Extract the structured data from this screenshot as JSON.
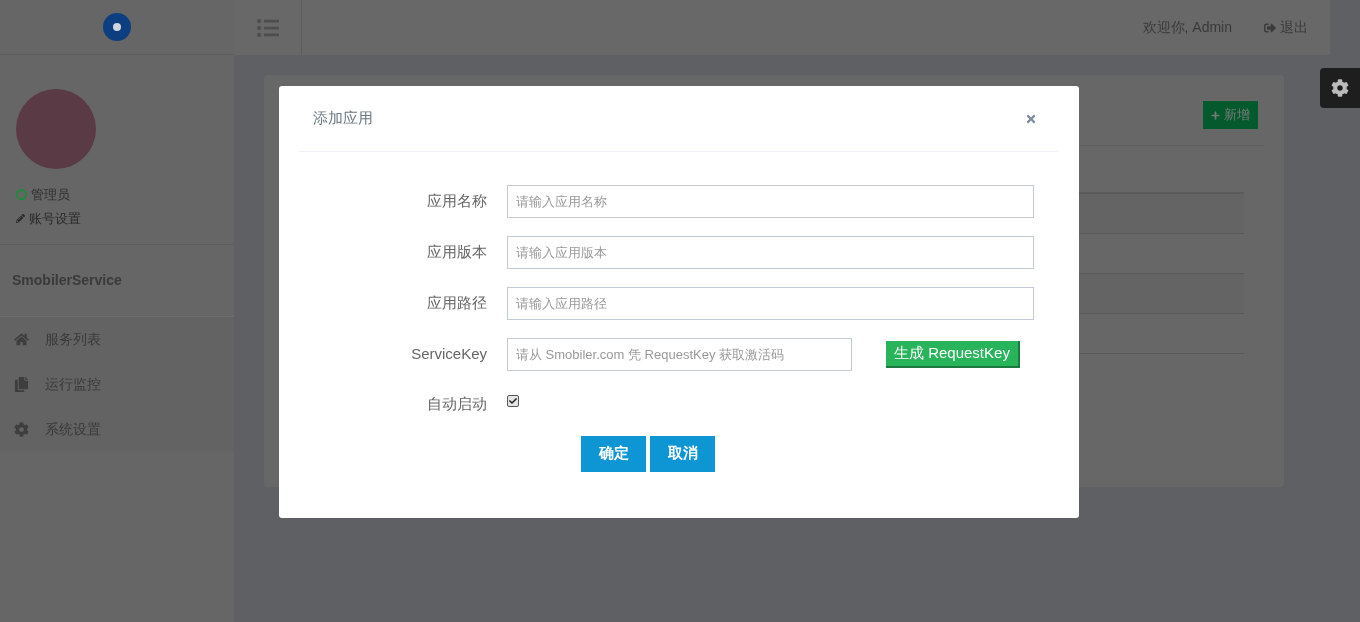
{
  "header": {
    "welcome": "欢迎你, Admin",
    "logout": "退出"
  },
  "sidebar": {
    "role": "管理员",
    "online": true,
    "account_settings": "账号设置",
    "app_name": "SmobilerService",
    "items": [
      {
        "label": "服务列表",
        "selected": false
      },
      {
        "label": "运行监控",
        "selected": false
      },
      {
        "label": "系统设置",
        "selected": false
      }
    ]
  },
  "content": {
    "add_button": "新增"
  },
  "dialog": {
    "title": "添加应用",
    "fields": [
      {
        "kind": "text",
        "label": "应用名称",
        "placeholder": "请输入应用名称"
      },
      {
        "kind": "text",
        "label": "应用版本",
        "placeholder": "请输入应用版本"
      },
      {
        "kind": "text",
        "label": "应用路径",
        "placeholder": "请输入应用路径"
      },
      {
        "kind": "key",
        "label": "ServiceKey",
        "placeholder": "请从 Smobiler.com 凭 RequestKey 获取激活码",
        "button": "生成 RequestKey"
      },
      {
        "kind": "checkbox",
        "label": "自动启动",
        "checked": true
      }
    ],
    "buttons": [
      "确定",
      "取消"
    ]
  }
}
